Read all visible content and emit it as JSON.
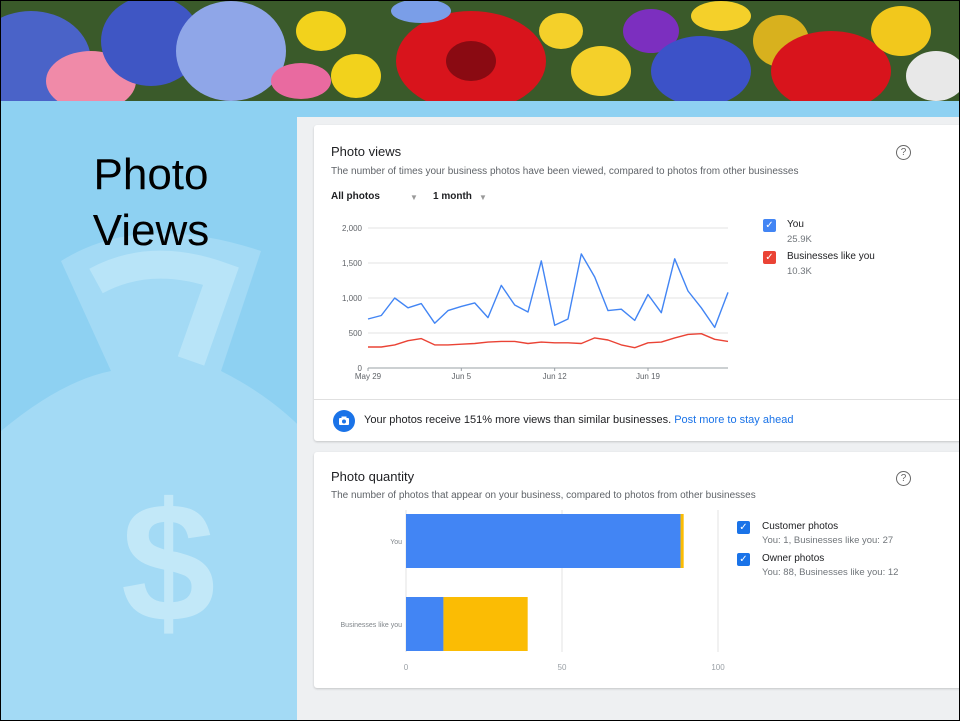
{
  "slide": {
    "title": "Photo Views"
  },
  "photo_views": {
    "title": "Photo views",
    "subtitle": "The number of times your business photos have been viewed, compared to photos from other businesses",
    "filter_label": "All photos",
    "range_label": "1 month",
    "legend": [
      {
        "name": "You",
        "value": "25.9K",
        "color": "#4285f4"
      },
      {
        "name": "Businesses like you",
        "value": "10.3K",
        "color": "#ea4335"
      }
    ],
    "info_text": "Your photos receive 151% more views than similar businesses.",
    "info_link": "Post more to stay ahead",
    "icons": [
      "help-icon",
      "camera-icon",
      "checkbox-icon",
      "dropdown-caret-icon"
    ]
  },
  "photo_quantity": {
    "title": "Photo quantity",
    "subtitle": "The number of photos that appear on your business, compared to photos from other businesses",
    "legend": [
      {
        "name": "Customer photos",
        "detail": "You: 1, Businesses like you: 27",
        "color": "#fbbc04"
      },
      {
        "name": "Owner photos",
        "detail": "You: 88, Businesses like you: 12",
        "color": "#4285f4"
      }
    ]
  },
  "chart_data": [
    {
      "type": "line",
      "x_ticks": [
        "May 29",
        "Jun 5",
        "Jun 12",
        "Jun 19"
      ],
      "y_ticks": [
        "0",
        "500",
        "1,000",
        "1,500",
        "2,000"
      ],
      "ylim": [
        0,
        2000
      ],
      "grid": true,
      "legend_position": "right",
      "series": [
        {
          "name": "You",
          "color": "#4285f4",
          "values": [
            700,
            750,
            1000,
            860,
            920,
            640,
            820,
            880,
            930,
            720,
            1180,
            900,
            800,
            1530,
            610,
            700,
            1630,
            1300,
            820,
            840,
            680,
            1050,
            790,
            1560,
            1100,
            860,
            580,
            1080
          ]
        },
        {
          "name": "Businesses like you",
          "color": "#ea4335",
          "values": [
            300,
            300,
            330,
            390,
            420,
            330,
            330,
            340,
            350,
            370,
            380,
            380,
            350,
            370,
            360,
            360,
            350,
            430,
            400,
            330,
            290,
            360,
            370,
            430,
            480,
            490,
            410,
            380
          ]
        }
      ]
    },
    {
      "type": "bar",
      "orientation": "horizontal",
      "stacked": true,
      "categories": [
        "You",
        "Businesses like you"
      ],
      "x_ticks": [
        "0",
        "50",
        "100"
      ],
      "xlim": [
        0,
        100
      ],
      "grid": true,
      "legend_position": "right",
      "series": [
        {
          "name": "Owner photos",
          "color": "#4285f4",
          "values": [
            88,
            12
          ]
        },
        {
          "name": "Customer photos",
          "color": "#fbbc04",
          "values": [
            1,
            27
          ]
        }
      ]
    }
  ]
}
